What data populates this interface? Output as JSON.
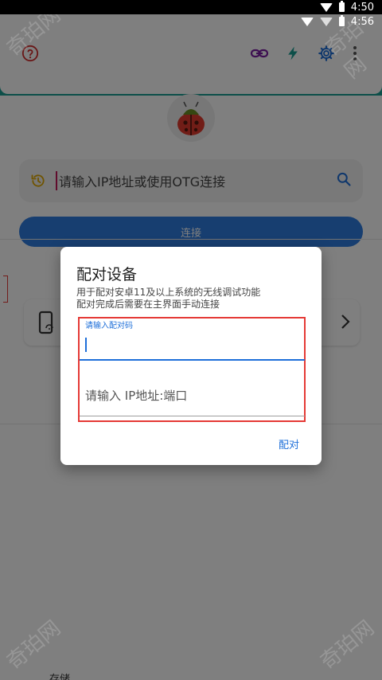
{
  "status_bar": {
    "time_top": "4:50",
    "time_second": "4:56"
  },
  "search": {
    "placeholder": "请输入IP地址或使用OTG连接"
  },
  "connect_button": {
    "label": "连接"
  },
  "bottom_partial_text": "存储",
  "dialog": {
    "title": "配对设备",
    "description_line1": "用于配对安卓11及以上系统的无线调试功能",
    "description_line2": "配对完成后需要在主界面手动连接",
    "pair_code_label": "请输入配对码",
    "ip_port_placeholder": "请输入 IP地址:端口",
    "pair_button": "配对"
  },
  "watermark_text": "奇珀网",
  "colors": {
    "accent_blue": "#1e6fd9",
    "teal": "#1a9e93",
    "highlight_red": "#e53935"
  },
  "icons": {
    "help": "help-circle-icon",
    "link": "link-icon",
    "flash": "flash-icon",
    "settings": "gear-icon",
    "more": "more-vert-icon",
    "history": "history-icon",
    "search": "search-icon",
    "phone": "phone-wifi-icon",
    "chevron": "chevron-right-icon"
  }
}
